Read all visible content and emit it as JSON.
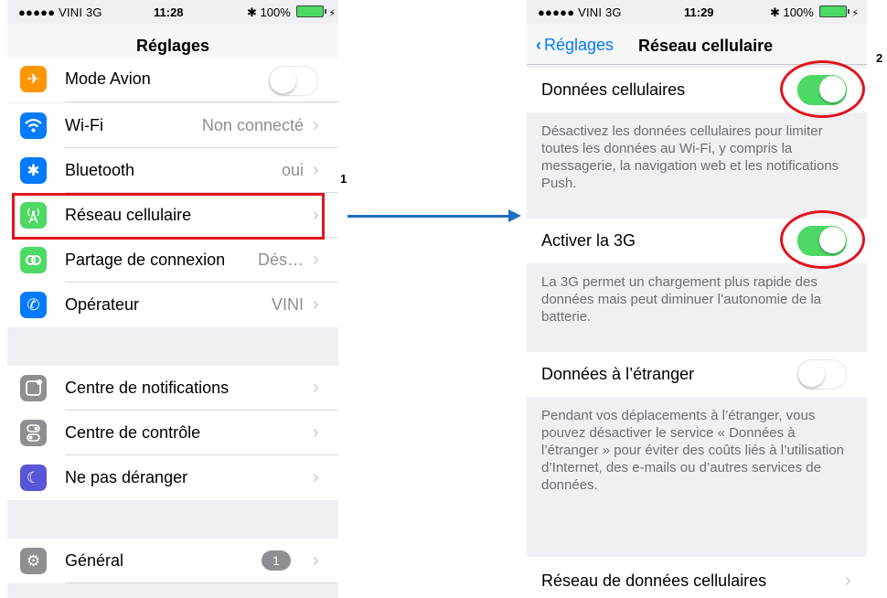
{
  "left": {
    "status": {
      "carrier": "●●●●● VINI  3G",
      "time": "11:28",
      "bluetooth": "✱",
      "battery": "100%"
    },
    "nav_title": "Réglages",
    "rows": [
      {
        "label": "Mode Avion",
        "icon": "airplane-icon",
        "toggle": "off"
      },
      {
        "label": "Wi-Fi",
        "icon": "wifi-icon",
        "value": "Non connecté"
      },
      {
        "label": "Bluetooth",
        "icon": "bluetooth-icon",
        "value": "oui"
      },
      {
        "label": "Réseau cellulaire",
        "icon": "cellular-antenna-icon",
        "value": ""
      },
      {
        "label": "Partage de connexion",
        "icon": "hotspot-icon",
        "value": "Dés…"
      },
      {
        "label": "Opérateur",
        "icon": "phone-icon",
        "value": "VINI"
      },
      {
        "label": "Centre de notifications",
        "icon": "notifications-icon"
      },
      {
        "label": "Centre de contrôle",
        "icon": "control-center-icon"
      },
      {
        "label": "Ne pas déranger",
        "icon": "moon-icon"
      },
      {
        "label": "Général",
        "icon": "gear-icon",
        "badge": "1"
      }
    ]
  },
  "right": {
    "status": {
      "carrier": "●●●●● VINI  3G",
      "time": "11:29",
      "bluetooth": "✱",
      "battery": "100%"
    },
    "back_label": "Réglages",
    "nav_title": "Réseau cellulaire",
    "rows": [
      {
        "label": "Données cellulaires",
        "toggle": "on"
      },
      {
        "label": "Activer la 3G",
        "toggle": "on"
      },
      {
        "label": "Données à l’étranger",
        "toggle": "off"
      },
      {
        "label": "Réseau de données cellulaires"
      }
    ],
    "footers": [
      "Désactivez les données cellulaires pour limiter toutes les données au Wi-Fi, y compris la messagerie, la navigation web et les notifications Push.",
      "La 3G permet un chargement plus rapide des données mais peut diminuer l’autonomie de la batterie.",
      "Pendant vos déplacements à l’étranger, vous pouvez désactiver le service « Données à l’étranger » pour éviter des coûts liés à l’utilisation d’Internet, des e-mails ou d’autres services de données."
    ]
  },
  "annotations": {
    "step1": "1",
    "step2": "2"
  },
  "colors": {
    "highlight": "#e0141b",
    "arrow": "#1e6fbf",
    "toggle_on": "#4cd964",
    "link": "#007aff"
  }
}
